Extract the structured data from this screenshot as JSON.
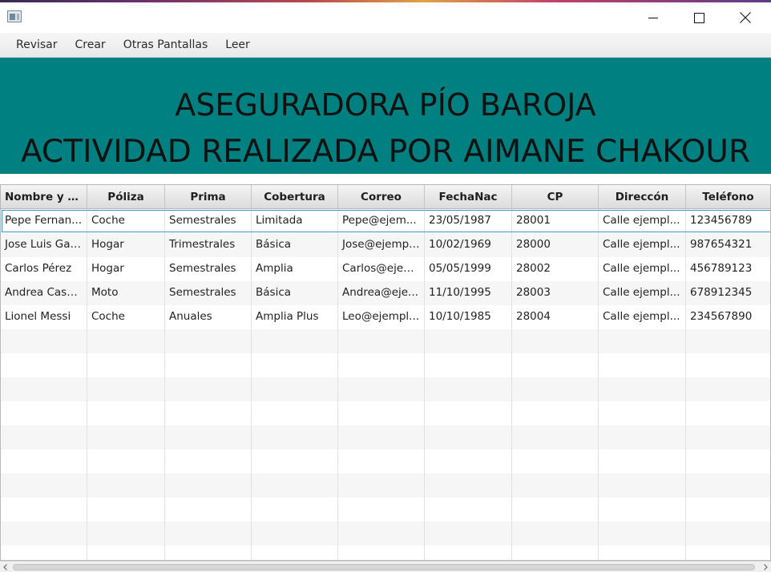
{
  "window": {
    "title": "",
    "icons": {
      "app": "app-icon",
      "minimize": "minimize-icon",
      "maximize": "maximize-icon",
      "close": "close-icon"
    }
  },
  "menu": {
    "items": [
      {
        "label": "Revisar"
      },
      {
        "label": "Crear"
      },
      {
        "label": "Otras Pantallas"
      },
      {
        "label": "Leer"
      }
    ]
  },
  "banner": {
    "line1": "ASEGURADORA PÍO BAROJA",
    "line2": "ACTIVIDAD REALIZADA POR AIMANE CHAKOUR",
    "background": "#008080"
  },
  "table": {
    "columns": [
      "Nombre y a...",
      "Póliza",
      "Prima",
      "Cobertura",
      "Correo",
      "FechaNac",
      "CP",
      "Direccón",
      "Teléfono"
    ],
    "rows": [
      [
        "Pepe Fernan...",
        "Coche",
        "Semestrales",
        "Limitada",
        "Pepe@ejem...",
        "23/05/1987",
        "28001",
        "Calle ejempl...",
        "123456789"
      ],
      [
        "Jose Luis Gar...",
        "Hogar",
        "Trimestrales",
        "Básica",
        "Jose@ejempl...",
        "10/02/1969",
        "28000",
        "Calle ejempl...",
        "987654321"
      ],
      [
        "Carlos Pérez",
        "Hogar",
        "Semestrales",
        "Amplia",
        "Carlos@ejem...",
        "05/05/1999",
        "28002",
        "Calle ejempl...",
        "456789123"
      ],
      [
        "Andrea Casa...",
        "Moto",
        "Semestrales",
        "Básica",
        "Andrea@eje...",
        "11/10/1995",
        "28003",
        "Calle ejempl...",
        "678912345"
      ],
      [
        "Lionel Messi",
        "Coche",
        "Anuales",
        "Amplia Plus",
        "Leo@ejempl...",
        "10/10/1985",
        "28004",
        "Calle ejempl...",
        "234567890"
      ]
    ],
    "selected_row": 0,
    "empty_rows": 10
  },
  "colors": {
    "accent": "#3b96c8",
    "banner": "#008080"
  }
}
